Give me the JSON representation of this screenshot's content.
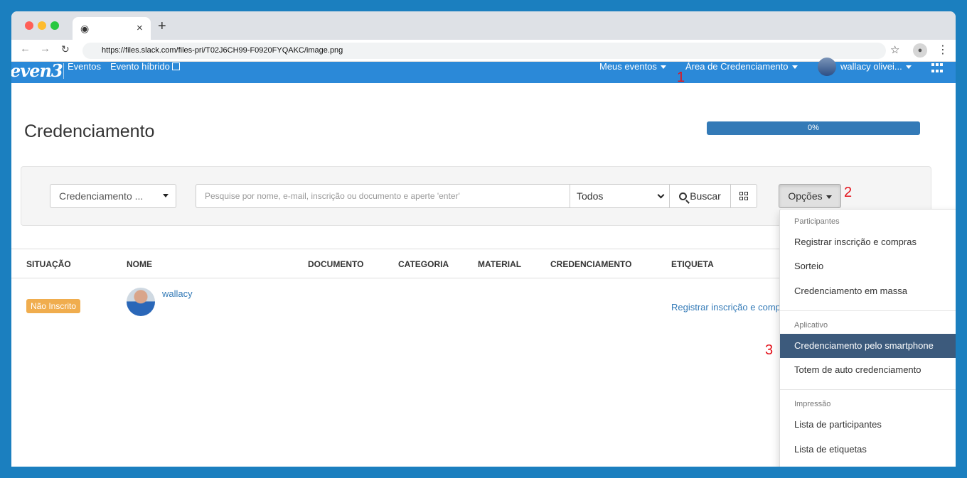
{
  "browser": {
    "tab_close": "×",
    "new_tab": "+",
    "url": "https://files.slack.com/files-pri/T02J6CH99-F0920FYQAKC/image.png"
  },
  "navbar": {
    "logo": "even3",
    "links": [
      "Eventos",
      "Evento híbrido"
    ],
    "right_menus": [
      "Meus eventos",
      "Área de Credenciamento",
      "wallacy olivei..."
    ]
  },
  "annotations": [
    "1",
    "2",
    "3"
  ],
  "page": {
    "title": "Credenciamento",
    "progress": {
      "label": "0%",
      "value": 0
    }
  },
  "filters": {
    "credenciamento_select": "Credenciamento ...",
    "search_placeholder": "Pesquise por nome, e-mail, inscrição ou documento e aperte 'enter'",
    "status_select": "Todos",
    "search_button": "Buscar",
    "options_button": "Opções"
  },
  "table": {
    "headers": [
      "SITUAÇÃO",
      "NOME",
      "DOCUMENTO",
      "CATEGORIA",
      "MATERIAL",
      "CREDENCIAMENTO",
      "ETIQUETA"
    ],
    "rows": [
      {
        "status": "Não Inscrito",
        "name": "wallacy",
        "label_link": "Registrar inscrição e compras"
      }
    ]
  },
  "options_menu": {
    "sections": [
      {
        "header": "Participantes",
        "items": [
          "Registrar inscrição e compras",
          "Sorteio",
          "Credenciamento em massa"
        ]
      },
      {
        "header": "Aplicativo",
        "items": [
          "Credenciamento pelo smartphone",
          "Totem de auto credenciamento"
        ]
      },
      {
        "header": "Impressão",
        "items": [
          "Lista de participantes",
          "Lista de etiquetas"
        ]
      }
    ],
    "active_item": "Credenciamento pelo smartphone"
  },
  "colors": {
    "navbar": "#2b89d8",
    "page_background": "#1b7fbf",
    "badge_warning": "#f0ad4e",
    "link": "#337ab7",
    "menu_active": "#3c5a7c",
    "annotation": "#e3121b"
  }
}
